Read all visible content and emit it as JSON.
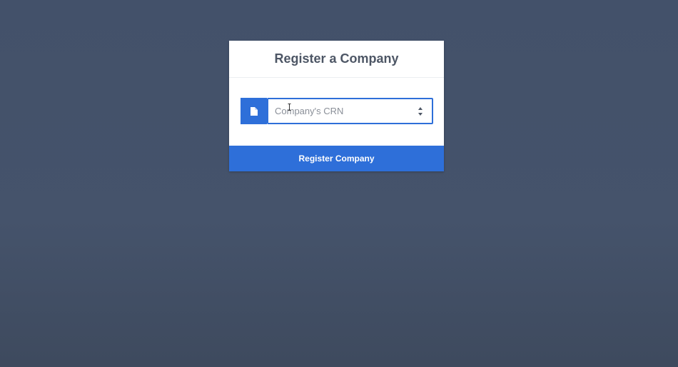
{
  "form": {
    "title": "Register a Company",
    "crn_field": {
      "placeholder": "Company's CRN",
      "value": "",
      "icon": "document-icon"
    },
    "submit_label": "Register Company"
  },
  "colors": {
    "background": "#43516a",
    "accent": "#2e6fd9",
    "title_text": "#4d5665"
  }
}
